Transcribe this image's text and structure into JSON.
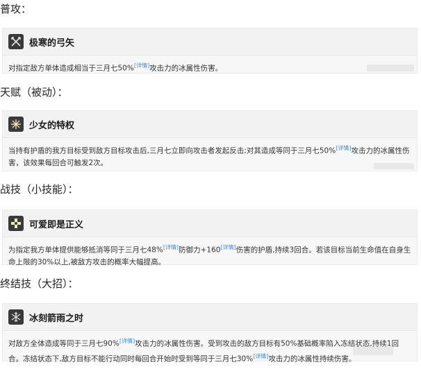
{
  "sections": [
    {
      "heading": "普攻：",
      "skill_name": "极寒的弓矢",
      "icon": "crossed-arrows-icon",
      "desc_parts": [
        "对指定敌方单体造成相当于三月七50%",
        "[详情]",
        "攻击力的冰属性伤害。"
      ]
    },
    {
      "heading": "天赋（被动）：",
      "skill_name": "少女的特权",
      "icon": "snowflake-burst-icon",
      "desc_parts": [
        "当持有护盾的我方目标受到敌方目标攻击后,三月七立即向攻击者发起反击;对其造成等同于三月七50%",
        "[详情]",
        "攻击力的冰属性伤害，该效果每回合可触发2次。"
      ]
    },
    {
      "heading": "战技（小技能）：",
      "skill_name": "可爱即是正义",
      "icon": "shield-cross-icon",
      "desc_parts": [
        "为指定我方单体提供能够抵消等同于三月七48%",
        "[详情]",
        "防御力+160",
        "[详情]",
        "伤害的护盾,持续3回合。若该目标当前生命值在自身生命上限的30%以上,被敌方攻击的概率大幅提高。"
      ]
    },
    {
      "heading": "终结技（大招）：",
      "skill_name": "冰刻箭雨之时",
      "icon": "ice-shards-icon",
      "desc_parts": [
        "对敌方全体造成等同于三月七90%",
        "[详情]",
        "攻击力的冰属性伤害。受到攻击的敌方目标有50%基础概率陷入冻结状态,持续1回合。冻结状态下,敌方目标不能行动同时每回合开始时受到等同于三月七30%",
        "[详情]",
        "攻击力的冰属性持续伤害。"
      ]
    }
  ],
  "colors": {
    "detail_tag": "#3a8fd6",
    "card_bg": "#f7f7f7",
    "icon_bg": "#3a3a3a"
  }
}
